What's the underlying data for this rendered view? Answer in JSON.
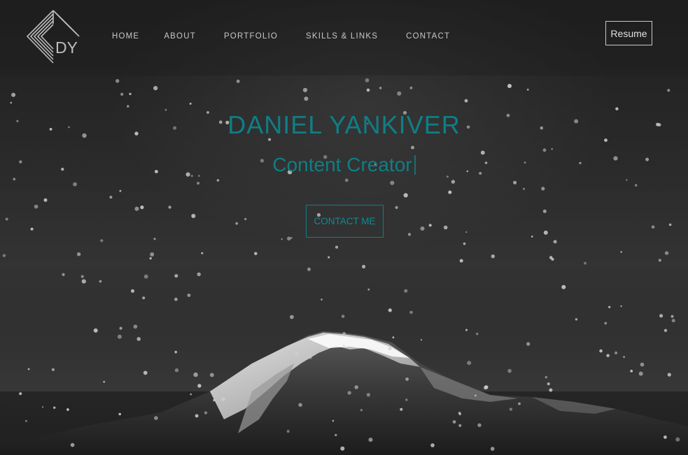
{
  "brand": {
    "logo_text": "DY"
  },
  "nav": {
    "items": [
      {
        "label": "HOME"
      },
      {
        "label": "ABOUT"
      },
      {
        "label": "PORTFOLIO"
      },
      {
        "label": "SKILLS & LINKS"
      },
      {
        "label": "CONTACT"
      }
    ],
    "resume_label": "Resume"
  },
  "hero": {
    "title": "DANIEL YANKIVER",
    "subtitle": "Content Creator",
    "cta_label": "CONTACT ME"
  },
  "colors": {
    "accent": "#0f7e86",
    "nav_text": "#c8c8c8",
    "background": "#1c1c1c"
  }
}
